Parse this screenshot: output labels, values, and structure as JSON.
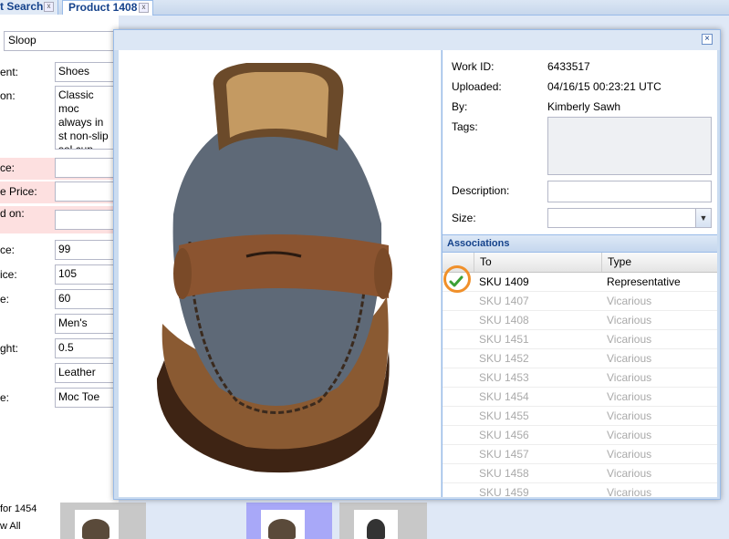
{
  "tabs": [
    {
      "label": "t Search"
    },
    {
      "label": "Product 1408"
    }
  ],
  "tab_close_glyph": "x",
  "bg_form": {
    "name_value": "Sloop",
    "rows": [
      {
        "label": "ent:",
        "value": "Shoes",
        "required": false
      },
      {
        "label": "on:",
        "value": "Classic moc always in st non-slip sol cup. Genuii construction",
        "required": false,
        "multiline": true
      },
      {
        "label": "ce:",
        "value": "",
        "required": true
      },
      {
        "label": "e Price:",
        "value": "",
        "required": true
      },
      {
        "label": "d on:",
        "value": "",
        "required": true
      },
      {
        "label": "ce:",
        "value": "99",
        "required": false
      },
      {
        "label": "ice:",
        "value": "105",
        "required": false
      },
      {
        "label": "e:",
        "value": "60",
        "required": false
      },
      {
        "label": "",
        "value": "Men's",
        "required": false
      },
      {
        "label": "ght:",
        "value": "0.5",
        "required": false
      },
      {
        "label": "",
        "value": "Leather",
        "required": false
      },
      {
        "label": "e:",
        "value": "Moc Toe",
        "required": false
      }
    ],
    "bottom_text_1": "for 1454",
    "bottom_text_2": "w All"
  },
  "modal": {
    "close_glyph": "×",
    "work_id_label": "Work ID:",
    "work_id": "6433517",
    "uploaded_label": "Uploaded:",
    "uploaded": "04/16/15 00:23:21 UTC",
    "by_label": "By:",
    "by": "Kimberly Sawh",
    "tags_label": "Tags:",
    "description_label": "Description:",
    "description_value": "",
    "size_label": "Size:",
    "size_value": "",
    "associations_title": "Associations",
    "columns": [
      "To",
      "Type"
    ],
    "associations": [
      {
        "to": "SKU 1409",
        "type": "Representative",
        "checked": true
      },
      {
        "to": "SKU 1407",
        "type": "Vicarious",
        "checked": false
      },
      {
        "to": "SKU 1408",
        "type": "Vicarious",
        "checked": false
      },
      {
        "to": "SKU 1451",
        "type": "Vicarious",
        "checked": false
      },
      {
        "to": "SKU 1452",
        "type": "Vicarious",
        "checked": false
      },
      {
        "to": "SKU 1453",
        "type": "Vicarious",
        "checked": false
      },
      {
        "to": "SKU 1454",
        "type": "Vicarious",
        "checked": false
      },
      {
        "to": "SKU 1455",
        "type": "Vicarious",
        "checked": false
      },
      {
        "to": "SKU 1456",
        "type": "Vicarious",
        "checked": false
      },
      {
        "to": "SKU 1457",
        "type": "Vicarious",
        "checked": false
      },
      {
        "to": "SKU 1458",
        "type": "Vicarious",
        "checked": false
      },
      {
        "to": "SKU 1459",
        "type": "Vicarious",
        "checked": false
      }
    ]
  },
  "colors": {
    "accent": "#15428b",
    "highlight_ring": "#f0902a",
    "check_green": "#3aa035",
    "required_bg": "#fde0e0"
  }
}
